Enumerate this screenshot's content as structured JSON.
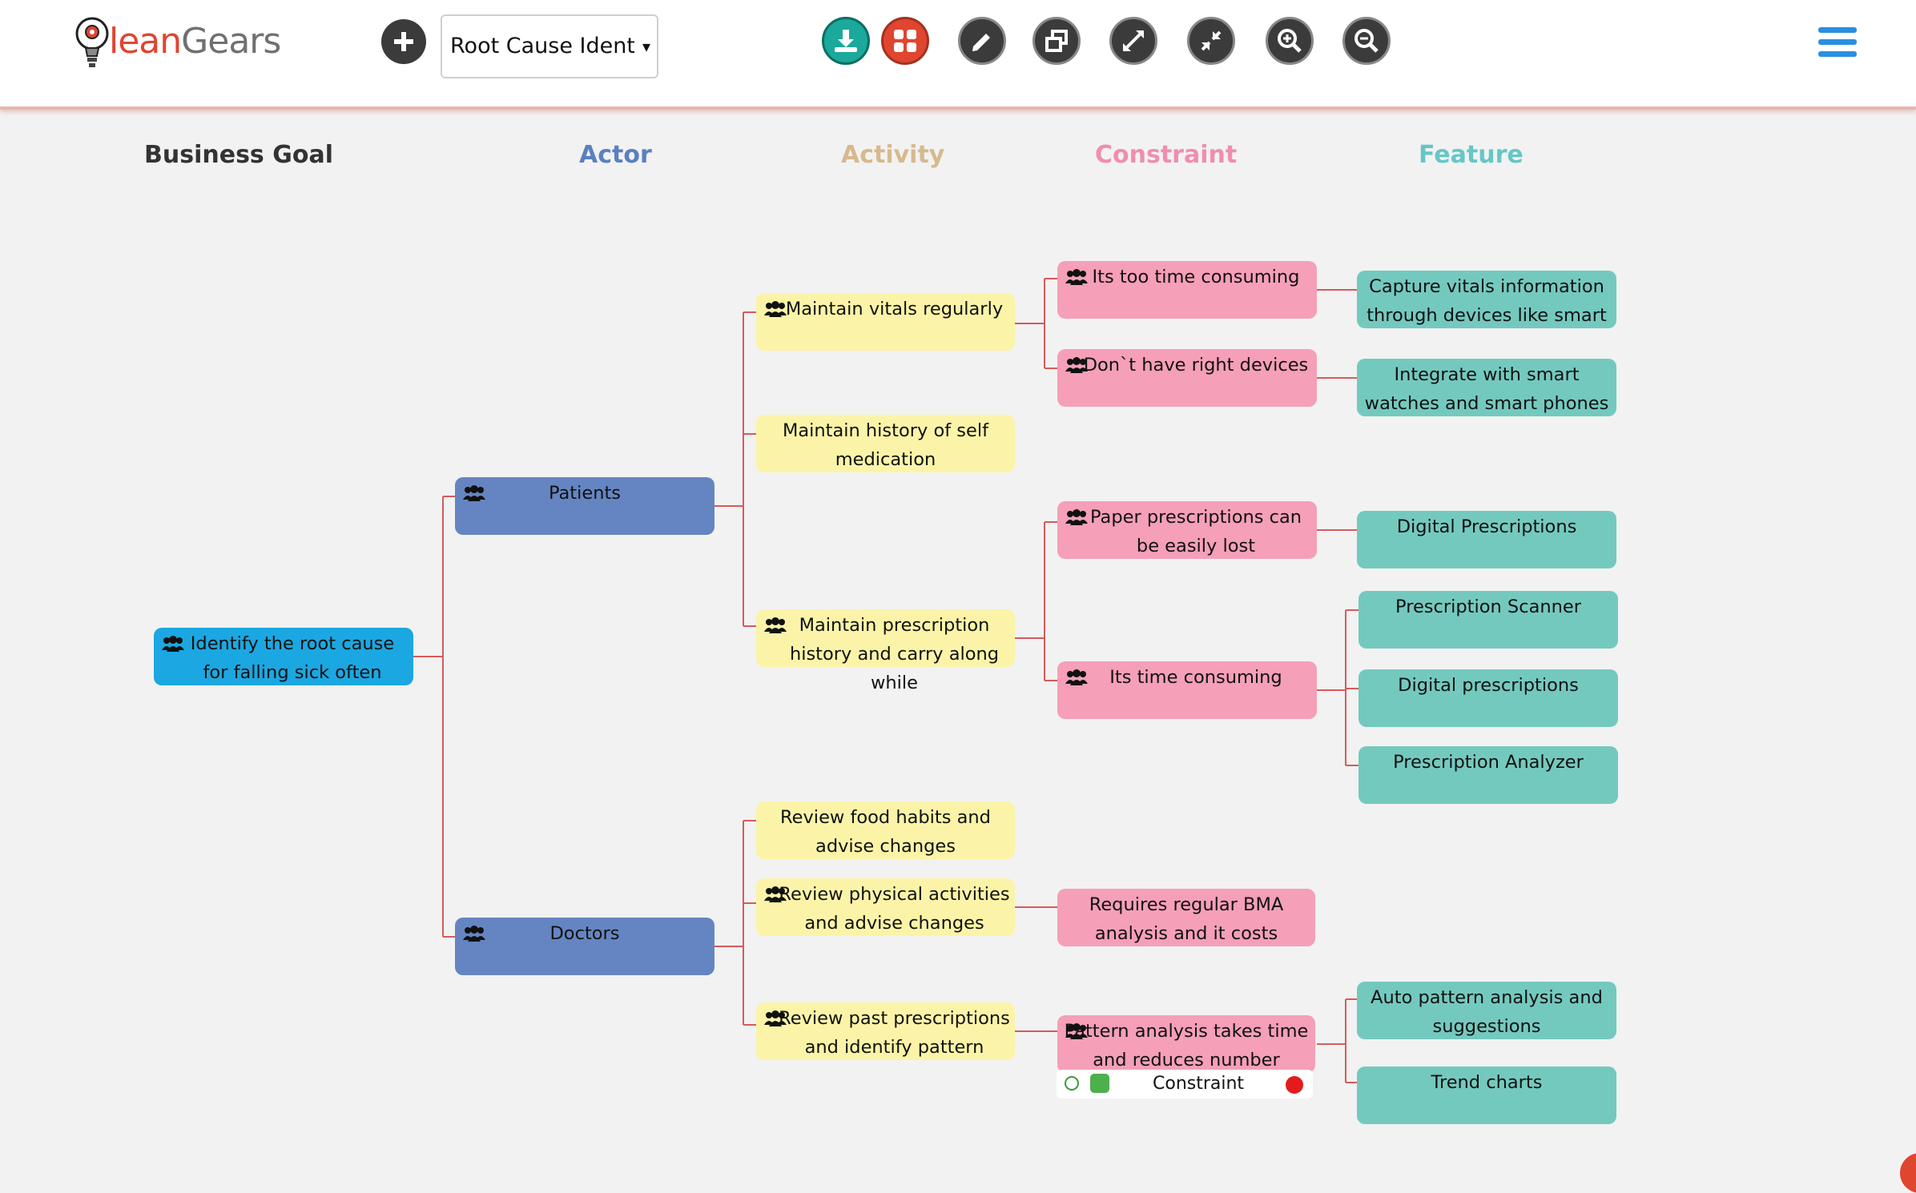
{
  "app": {
    "logo_text_1": "lean",
    "logo_text_2": "Gears"
  },
  "toolbar": {
    "add_icon": "plus-circle-icon",
    "project_select": {
      "value": "Root Cause Identific",
      "caret": "▾"
    },
    "tools": [
      "download-icon",
      "grid-icon",
      "pencil-icon",
      "restore-window-icon",
      "expand-icon",
      "collapse-icon",
      "zoom-in-icon",
      "zoom-out-icon"
    ],
    "menu_icon": "hamburger-menu-icon"
  },
  "columns": {
    "goal": "Business Goal",
    "actor": "Actor",
    "activity": "Activity",
    "constraint": "Constraint",
    "feature": "Feature"
  },
  "colors": {
    "goal_header": "#333333",
    "actor_header": "#5a80c0",
    "activity_header": "#d7b98d",
    "constraint_header": "#f08db0",
    "feature_header": "#66c6c6",
    "goal": "#1ba7e1",
    "actor": "#6585c2",
    "activity": "#fbf4a8",
    "constraint": "#f59fb8",
    "feature": "#74c9bf",
    "link": "#d75a5a"
  },
  "nodes": {
    "goal": "Identify the root cause for falling sick often",
    "patients": "Patients",
    "doctors": "Doctors",
    "act_vitals": "Maintain vitals regularly",
    "act_history": "Maintain history of self medication",
    "act_prescription": "Maintain prescription history and carry along while",
    "act_food": "Review food habits and advise changes",
    "act_physical": "Review physical activities and advise changes",
    "act_past": "Review past prescriptions and identify pattern",
    "con_time": "Its too time consuming",
    "con_devices": "Don`t have right devices",
    "con_paper": "Paper prescriptions can be easily lost",
    "con_time2": "Its time consuming",
    "con_bma": "Requires regular BMA analysis and it costs",
    "con_pattern": "Pattern analysis takes time and reduces number patients I",
    "feat_capture": "Capture vitals information through devices like smart",
    "feat_integrate": "Integrate with smart watches and smart phones",
    "feat_digital": "Digital Prescriptions",
    "feat_scanner": "Prescription Scanner",
    "feat_digital2": "Digital prescriptions",
    "feat_analyzer": "Prescription Analyzer",
    "feat_auto": "Auto pattern analysis and suggestions",
    "feat_trend": "Trend charts"
  },
  "edit_bar": {
    "label": "Constraint",
    "add_icon": "add-circle-icon",
    "edit_icon": "edit-icon",
    "delete_icon": "delete-icon"
  },
  "people_icon": "people-group-icon"
}
